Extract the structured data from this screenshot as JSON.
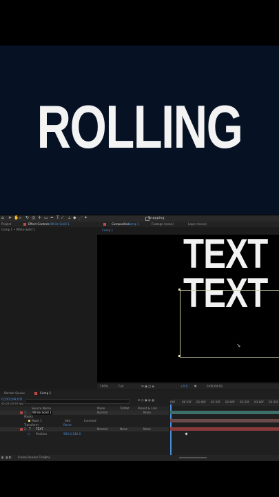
{
  "banner": {
    "title": "ROLLING"
  },
  "toolbar": {
    "snapping_label": "Snapping"
  },
  "left_panel": {
    "project_tab": "Project",
    "effect_controls_tab": "Effect Controls",
    "effect_controls_layer": "White Solid 1",
    "breadcrumb": "Comp 1 • White Solid 1"
  },
  "comp_panel": {
    "composition_tab": "Composition",
    "composition_name": "Comp 1",
    "footage_tab": "Footage (none)",
    "layer_tab": "Layer (none)",
    "comp_subtab": "Comp 1",
    "artwork_text_top": "TEXT",
    "artwork_text_bottom": "TEXT",
    "zoom": "100%",
    "resolution": "Full",
    "exposure": "+0.0",
    "timecode": "0;00;04;09"
  },
  "timeline": {
    "render_queue_tab": "Render Queue",
    "comp_tab": "Comp 1",
    "current_time": "0;00;04;09",
    "frame_info": "00129 (29.97 fps)",
    "col_source_name": "Source Name",
    "col_mode": "Mode",
    "col_trkmat": "TrkMat",
    "col_parent": "Parent & Link",
    "layers": [
      {
        "num": "1",
        "name": "White Solid 1",
        "mode": "Normal",
        "parent": "None"
      },
      {
        "num": "2",
        "name": "TEXT",
        "mode": "Normal",
        "trkmat": "None",
        "parent": "None"
      }
    ],
    "masks_label": "Masks",
    "mask_name": "Mask 1",
    "mask_mode": "Add",
    "mask_inverted": "Inverted",
    "reset_label": "Reset",
    "transform_label": "Transform",
    "position_label": "Position",
    "position_value": "960.0,540.0",
    "ruler": [
      "00f",
      "00:15f",
      "01:00f",
      "01:15f",
      "02:00f",
      "02:15f",
      "03:00f",
      "03:15f"
    ],
    "frame_render_label": "Frame Render Time",
    "frame_render_value": "3ms"
  },
  "colors": {
    "banner_bg": "#061224",
    "ae_blue": "#4a8fd8",
    "layer_red": "#b04848",
    "track_teal": "#3f6f6a"
  }
}
